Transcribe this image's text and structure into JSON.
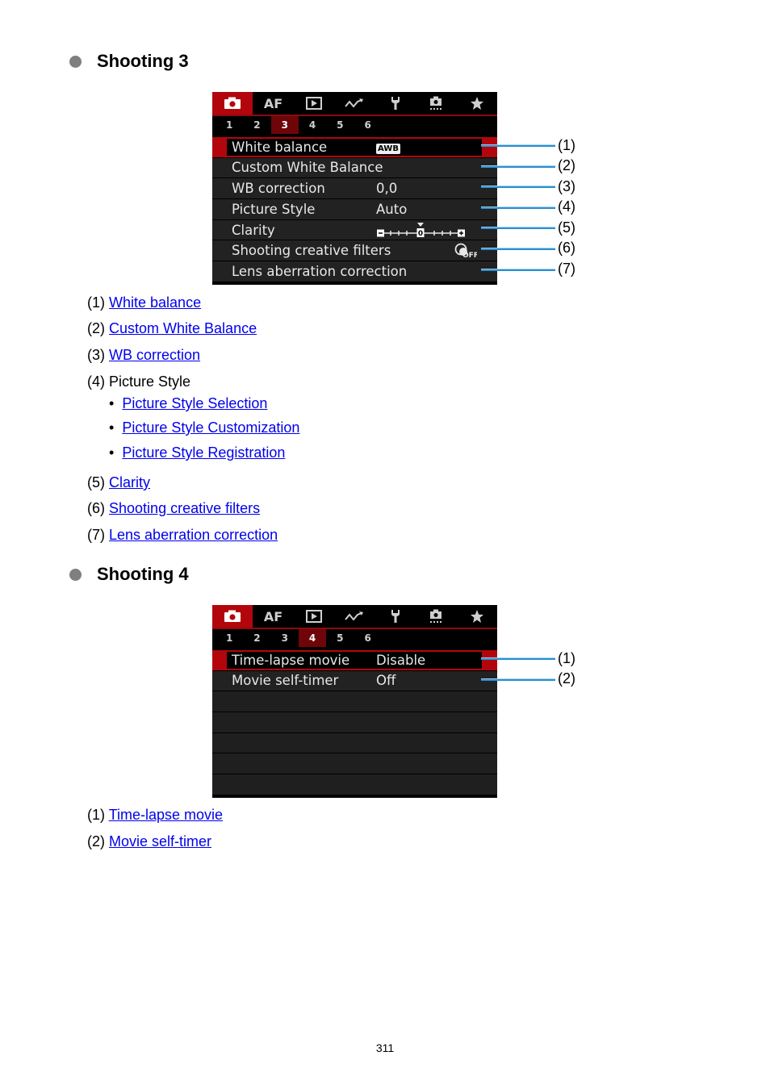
{
  "sections": [
    {
      "heading": "Shooting 3",
      "camera_menu": {
        "tabs": [
          {
            "icon": "camera-icon",
            "label": "",
            "active": true
          },
          {
            "icon": "af-tab",
            "label": "AF",
            "active": false
          },
          {
            "icon": "playback-icon",
            "label": "",
            "active": false
          },
          {
            "icon": "wireless-icon",
            "label": "",
            "active": false
          },
          {
            "icon": "wrench-icon",
            "label": "",
            "active": false
          },
          {
            "icon": "custom-functions-icon",
            "label": "",
            "active": false
          },
          {
            "icon": "star-icon",
            "label": "",
            "active": false
          }
        ],
        "subtabs": [
          "1",
          "2",
          "3",
          "4",
          "5",
          "6"
        ],
        "active_subtab": "3",
        "rows": [
          {
            "label": "White balance",
            "value": "AWB",
            "value_type": "badge",
            "selected": true
          },
          {
            "label": "Custom White Balance",
            "value": "",
            "selected": false
          },
          {
            "label": "WB correction",
            "value": "0,0",
            "selected": false
          },
          {
            "label": "Picture Style",
            "value": "Auto",
            "selected": false
          },
          {
            "label": "Clarity",
            "value": "0",
            "value_type": "slider",
            "slider_min": -4,
            "slider_max": 4,
            "selected": false
          },
          {
            "label": "Shooting creative filters",
            "value": "OFF",
            "value_type": "filter-off-icon",
            "selected": false
          },
          {
            "label": "Lens aberration correction",
            "value": "",
            "selected": false
          }
        ],
        "callouts": [
          "(1)",
          "(2)",
          "(3)",
          "(4)",
          "(5)",
          "(6)",
          "(7)"
        ]
      },
      "list": [
        {
          "num": "(1)",
          "link": "White balance"
        },
        {
          "num": "(2)",
          "link": "Custom White Balance"
        },
        {
          "num": "(3)",
          "link": "WB correction"
        },
        {
          "num": "(4)",
          "text": "Picture Style",
          "sub": [
            "Picture Style Selection",
            "Picture Style Customization",
            "Picture Style Registration"
          ]
        },
        {
          "num": "(5)",
          "link": "Clarity"
        },
        {
          "num": "(6)",
          "link": "Shooting creative filters"
        },
        {
          "num": "(7)",
          "link": "Lens aberration correction"
        }
      ]
    },
    {
      "heading": "Shooting 4",
      "camera_menu": {
        "subtabs": [
          "1",
          "2",
          "3",
          "4",
          "5",
          "6"
        ],
        "active_subtab": "4",
        "rows": [
          {
            "label": "Time-lapse movie",
            "value": "Disable",
            "selected": true
          },
          {
            "label": "Movie self-timer",
            "value": "Off",
            "selected": false
          }
        ],
        "callouts": [
          "(1)",
          "(2)"
        ]
      },
      "list": [
        {
          "num": "(1)",
          "link": "Time-lapse movie"
        },
        {
          "num": "(2)",
          "link": "Movie self-timer"
        }
      ]
    }
  ],
  "bullet_char": "•",
  "page_number": "311",
  "colors": {
    "accent_red": "#b3060c",
    "link_blue": "#0000ee",
    "callout_blue": "#2b8fd0"
  }
}
